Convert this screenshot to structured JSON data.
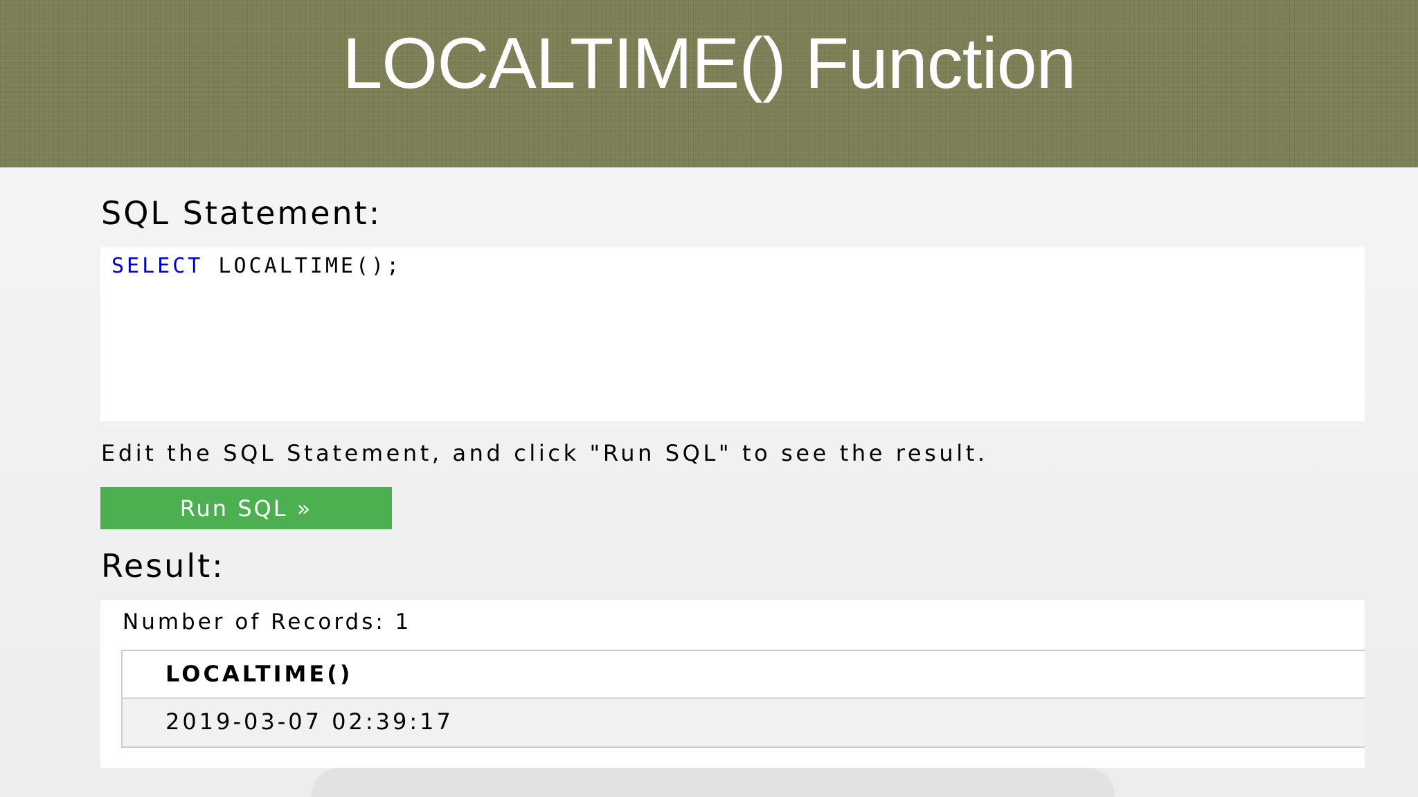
{
  "slide": {
    "title": "LOCALTIME() Function"
  },
  "editor": {
    "heading": "SQL Statement:",
    "keyword": "SELECT",
    "code_rest": " LOCALTIME();"
  },
  "hint_text": "Edit the SQL Statement, and click \"Run SQL\" to see the result.",
  "run_button_label": "Run SQL »",
  "result": {
    "heading": "Result:",
    "records_text": "Number of Records: 1",
    "columns": [
      "LOCALTIME()"
    ],
    "rows": [
      [
        "2019-03-07 02:39:17"
      ]
    ]
  },
  "colors": {
    "banner": "#7d7f57",
    "button": "#4caf50",
    "keyword": "#0000cd"
  }
}
